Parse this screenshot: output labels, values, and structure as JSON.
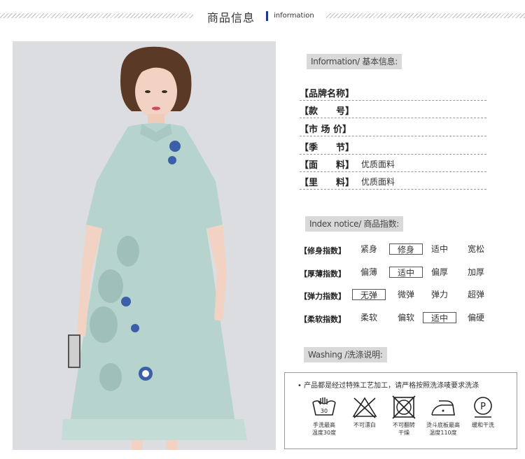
{
  "header": {
    "title": "商品信息",
    "subtitle": "information"
  },
  "basic_info": {
    "label": "Information/ 基本信息:",
    "rows": [
      {
        "key": "【品牌名称】",
        "value": ""
      },
      {
        "key": "【款　　号】",
        "value": ""
      },
      {
        "key": "【市 场 价】",
        "value": ""
      },
      {
        "key": "【季　　节】",
        "value": ""
      },
      {
        "key": "【面　　料】",
        "value": "优质面料"
      },
      {
        "key": "【里　　料】",
        "value": "优质面料"
      }
    ]
  },
  "index_notice": {
    "label": "Index notice/ 商品指数:",
    "rows": [
      {
        "label": "【修身指数】",
        "options": [
          "紧身",
          "修身",
          "适中",
          "宽松"
        ],
        "selected": 1
      },
      {
        "label": "【厚薄指数】",
        "options": [
          "偏薄",
          "适中",
          "偏厚",
          "加厚"
        ],
        "selected": 1
      },
      {
        "label": "【弹力指数】",
        "options": [
          "无弹",
          "微弹",
          "弹力",
          "超弹"
        ],
        "selected": 0
      },
      {
        "label": "【柔软指数】",
        "options": [
          "柔软",
          "偏软",
          "适中",
          "偏硬"
        ],
        "selected": 2
      }
    ]
  },
  "washing": {
    "label": "Washing /洗涤说明:",
    "note": "• 产品都是经过特殊工艺加工，请严格按照洗涤唛要求洗涤",
    "items": [
      {
        "icon": "hand-wash-icon",
        "line1": "手洗最高",
        "line2": "温度30度"
      },
      {
        "icon": "no-bleach-icon",
        "line1": "不可漂白",
        "line2": ""
      },
      {
        "icon": "no-tumble-dry-icon",
        "line1": "不可翻转",
        "line2": "干燥"
      },
      {
        "icon": "iron-icon",
        "line1": "烫斗底板最高",
        "line2": "温度110度"
      },
      {
        "icon": "dry-clean-icon",
        "line1": "缓和干洗",
        "line2": ""
      }
    ]
  },
  "icon_symbols": {
    "dry_clean_letter": "P",
    "hand_wash_temp": "30"
  },
  "colors": {
    "dress": "#b7d3cd",
    "background_photo": "#dcdde0",
    "section_label_bg": "#d9d9d9",
    "header_accent": "#1e3a8a"
  }
}
